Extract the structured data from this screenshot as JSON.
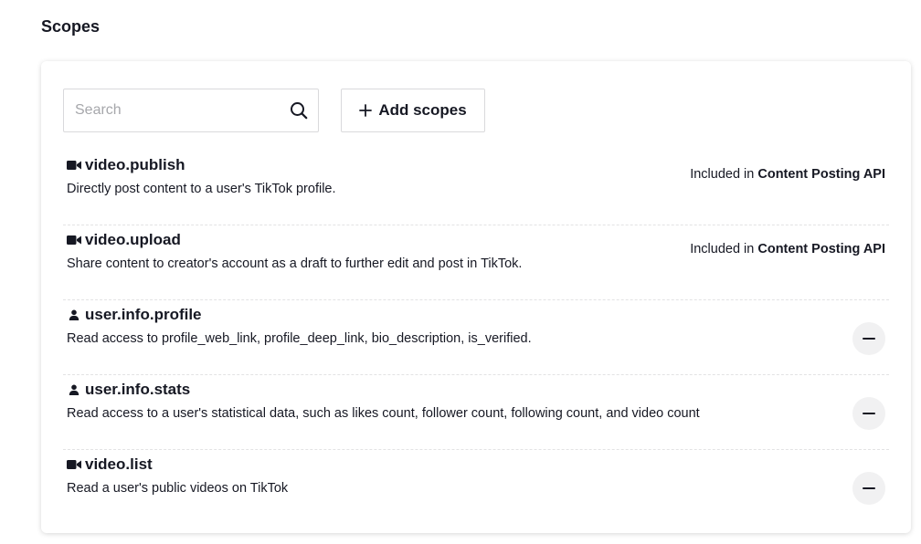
{
  "page": {
    "title": "Scopes"
  },
  "toolbar": {
    "search_placeholder": "Search",
    "search_value": "",
    "add_scopes_label": "Add scopes"
  },
  "scopes": [
    {
      "name": "video.publish",
      "icon": "video-camera-icon",
      "description": "Directly post content to a user's TikTok profile.",
      "included_prefix": "Included in",
      "included_product": "Content Posting API"
    },
    {
      "name": "video.upload",
      "icon": "video-camera-icon",
      "description": "Share content to creator's account as a draft to further edit and post in TikTok.",
      "included_prefix": "Included in",
      "included_product": "Content Posting API"
    },
    {
      "name": "user.info.profile",
      "icon": "user-icon",
      "description": "Read access to profile_web_link, profile_deep_link, bio_description, is_verified.",
      "action": "remove"
    },
    {
      "name": "user.info.stats",
      "icon": "user-icon",
      "description": "Read access to a user's statistical data, such as likes count, follower count, following count, and video count",
      "action": "remove"
    },
    {
      "name": "video.list",
      "icon": "video-camera-icon",
      "description": "Read a user's public videos on TikTok",
      "action": "remove"
    }
  ],
  "colors": {
    "text": "#161823",
    "border": "#d9d9dc",
    "divider": "#e3e3e4",
    "remove_button_bg": "#f1f1f2"
  }
}
